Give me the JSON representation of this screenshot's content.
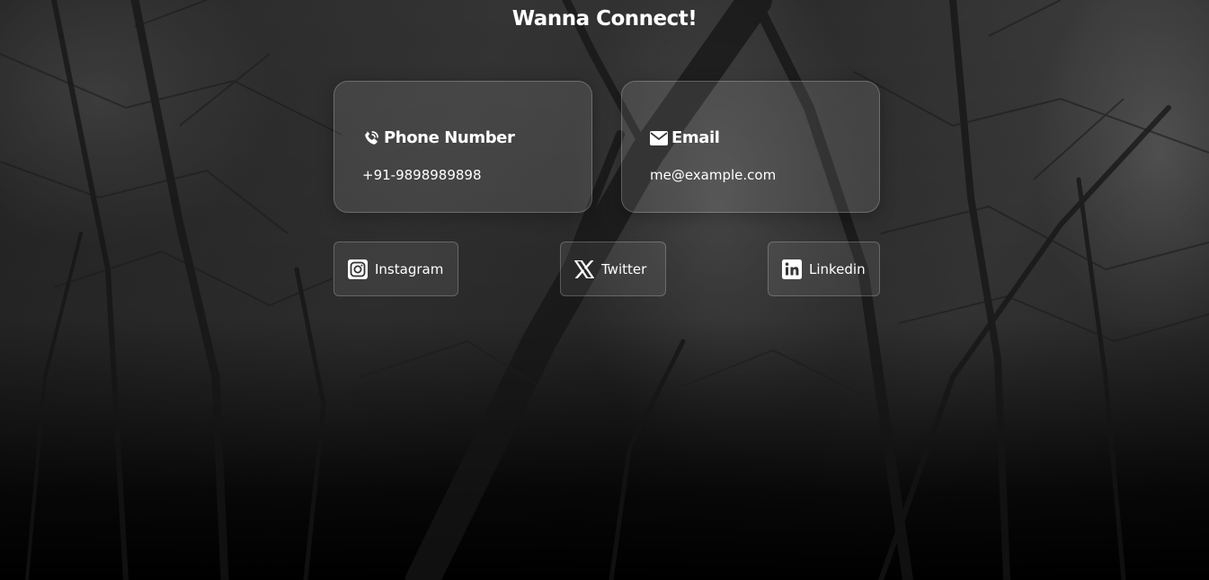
{
  "section": {
    "title": "Wanna Connect!"
  },
  "contact_cards": {
    "phone": {
      "icon": "phone-icon",
      "label": "Phone Number",
      "value": "+91-9898989898"
    },
    "email": {
      "icon": "envelope-icon",
      "label": "Email",
      "value": "me@example.com"
    }
  },
  "social_links": {
    "instagram": {
      "icon": "instagram-icon",
      "label": "Instagram"
    },
    "twitter": {
      "icon": "x-icon",
      "label": "Twitter"
    },
    "linkedin": {
      "icon": "linkedin-icon",
      "label": "Linkedin"
    }
  },
  "colors": {
    "text": "#ffffff",
    "card_background": "rgba(255,255,255,0.10)",
    "card_border": "rgba(255,255,255,0.22)"
  }
}
